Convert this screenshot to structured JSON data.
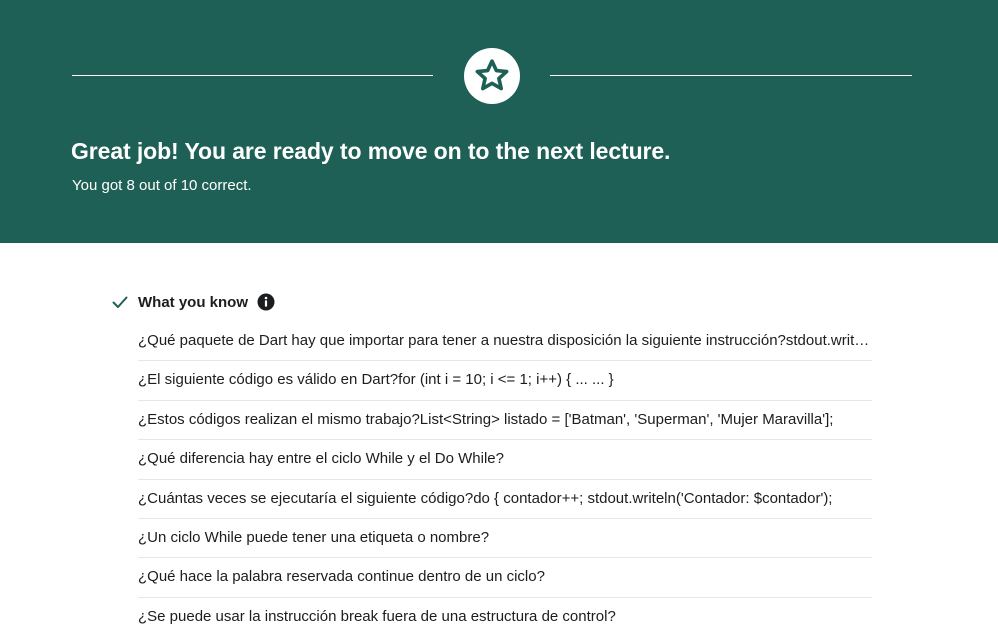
{
  "colors": {
    "hero_background": "#1e6055",
    "accent": "#1e6055",
    "text": "#1c1d1f"
  },
  "hero": {
    "badge_icon": "star-icon",
    "title": "Great job! You are ready to move on to the next lecture.",
    "subtitle": "You got 8 out of 10 correct."
  },
  "section": {
    "status_icon": "checkmark-icon",
    "title": "What you know",
    "info_icon": "info-icon"
  },
  "questions": [
    "¿Qué paquete de Dart hay que importar para tener a nuestra disposición la siguiente instrucción?stdout.writeln",
    "¿El siguiente código es válido en Dart?for (int i = 10; i <= 1; i++) { ... ... }",
    "¿Estos códigos realizan el mismo trabajo?List<String> listado = ['Batman', 'Superman', 'Mujer Maravilla'];",
    "¿Qué diferencia hay entre el ciclo While y el Do While?",
    "¿Cuántas veces se ejecutaría el siguiente código?do { contador++; stdout.writeln('Contador: $contador');",
    "¿Un ciclo While puede tener una etiqueta o nombre?",
    "¿Qué hace la palabra reservada continue dentro de un ciclo?",
    "¿Se puede usar la instrucción break fuera de una estructura de control?"
  ]
}
